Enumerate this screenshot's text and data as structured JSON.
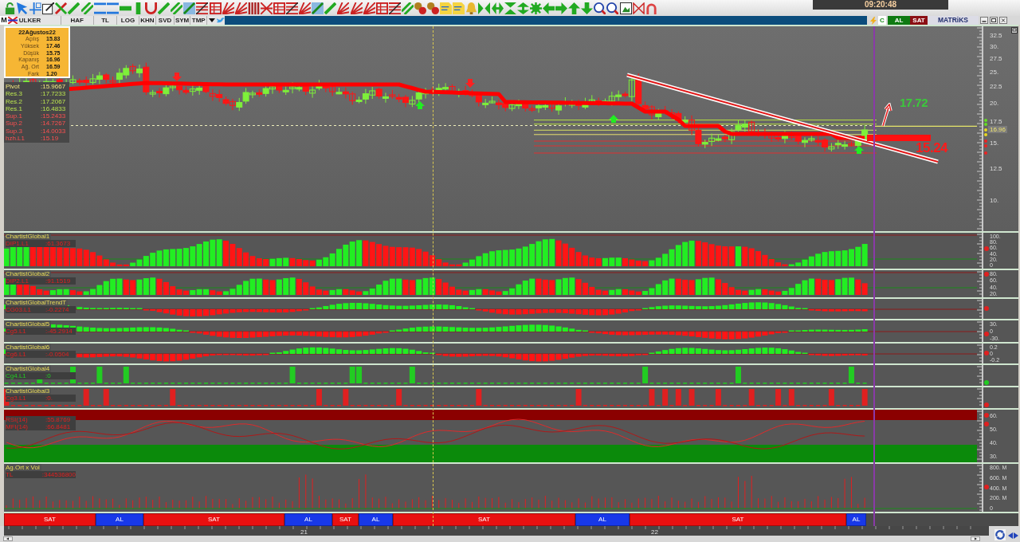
{
  "clock": "09:20:48",
  "symbol_bar": {
    "logo": "M",
    "symbol": "ULKER",
    "tabs": [
      "HAF",
      "TL",
      "LOG",
      "KHN",
      "SVD",
      "SYM",
      "TMP"
    ],
    "quick_buttons": [
      {
        "label": "C",
        "kind": "plain"
      },
      {
        "label": "AL",
        "kind": "buy"
      },
      {
        "label": "SAT",
        "kind": "sell"
      }
    ],
    "brand": "MATRiKS"
  },
  "info_box": {
    "title": "22Ağustos22",
    "rows": [
      {
        "label": "Açılış",
        "value": "15.83"
      },
      {
        "label": "Yüksek",
        "value": "17.46"
      },
      {
        "label": "Düşük",
        "value": "15.75"
      },
      {
        "label": "Kapanış",
        "value": "16.96"
      },
      {
        "label": "Ağ. Ort",
        "value": "16.59"
      },
      {
        "label": "Fark",
        "value": "1.20"
      }
    ]
  },
  "pivots": [
    {
      "label": "Pivot",
      "value": ":15.9667",
      "kind": "pivot"
    },
    {
      "label": "Res.3",
      "value": ":17.7233",
      "kind": "resistance"
    },
    {
      "label": "Res.2",
      "value": ":17.2067",
      "kind": "resistance"
    },
    {
      "label": "Res.1",
      "value": ":16.4833",
      "kind": "resistance"
    },
    {
      "label": "Sup.1",
      "value": ":15.2433",
      "kind": "support"
    },
    {
      "label": "Sup.2",
      "value": ":14.7267",
      "kind": "support"
    },
    {
      "label": "Sup.3",
      "value": ":14.0033",
      "kind": "support"
    },
    {
      "label": "hzh.L1",
      "value": ":15.19",
      "kind": "support"
    }
  ],
  "price_axis": {
    "ticks": [
      "32.5",
      "30.",
      "27.5",
      "25.",
      "22.5",
      "20.",
      "17.5",
      "15.",
      "12.5",
      "10."
    ],
    "last_price": "16.96"
  },
  "annotations": [
    {
      "text": "17.72",
      "kind": "target"
    },
    {
      "text": "15.24",
      "kind": "support"
    }
  ],
  "panels": [
    {
      "kind": "histogram",
      "title": "ChartistGlobal1",
      "series": [
        {
          "label": "DIP1.L1",
          "value": ":61.3673",
          "color": "#e02020"
        }
      ],
      "axis": [
        "100.",
        "80.",
        "60.",
        "40.",
        "20.",
        "0"
      ]
    },
    {
      "kind": "histogram",
      "title": "ChartistGlobal2",
      "series": [
        {
          "label": "DIP2.L1",
          "value": ":91.1519",
          "color": "#e02020"
        }
      ],
      "axis": [
        "80.",
        "60.",
        "40.",
        "20."
      ]
    },
    {
      "kind": "centered",
      "title": "ChartistGlobalTrendT",
      "series": [
        {
          "label": "CG03.L1",
          "value": ":-0.2274",
          "color": "#e02020"
        }
      ]
    },
    {
      "kind": "centered",
      "title": "ChartistGlobal5",
      "series": [
        {
          "label": "Cg5.L1",
          "value": ":-45.2914",
          "color": "#e02020"
        }
      ],
      "axis": [
        "30.",
        "0",
        "-30."
      ]
    },
    {
      "kind": "centered",
      "title": "ChartistGlobal6",
      "series": [
        {
          "label": "Cg6.L1",
          "value": ":-0.0504",
          "color": "#e02020"
        }
      ],
      "axis": [
        "0.2",
        "0",
        "-0.2"
      ]
    },
    {
      "kind": "spikes",
      "title": "ChartistGlobal4",
      "series": [
        {
          "label": "Cg4.L1",
          "value": ":0",
          "color": "#22cc22"
        }
      ]
    },
    {
      "kind": "spikes",
      "title": "ChartistGlobal3",
      "series": [
        {
          "label": "Cg3.L1",
          "value": ":0.",
          "color": "#e02020"
        }
      ]
    },
    {
      "kind": "bands",
      "series": [
        {
          "label": "RSI(14)",
          "value": ":55.8769",
          "color": "#e02020"
        },
        {
          "label": "MFI(14)",
          "value": ":66.8481",
          "color": "#e02020"
        }
      ],
      "axis": [
        "60.",
        "50.",
        "40.",
        "30."
      ]
    },
    {
      "kind": "volume",
      "title": "Ag.Ort x Vol",
      "series": [
        {
          "label": "TL",
          "value": ":344536800",
          "color": "#e02020"
        }
      ],
      "axis": [
        "800. M",
        "600. M",
        "400. M",
        "200. M",
        "0"
      ]
    }
  ],
  "signals": [
    {
      "label": "SAT",
      "kind": "sell"
    },
    {
      "label": "AL",
      "kind": "buy"
    },
    {
      "label": "SAT",
      "kind": "sell"
    },
    {
      "label": "AL",
      "kind": "buy"
    },
    {
      "label": "SAT",
      "kind": "sell"
    },
    {
      "label": "AL",
      "kind": "buy"
    },
    {
      "label": "SAT",
      "kind": "sell"
    },
    {
      "label": "AL",
      "kind": "buy"
    },
    {
      "label": "SAT",
      "kind": "sell"
    },
    {
      "label": "AL",
      "kind": "buy"
    }
  ],
  "dates": [
    "21",
    "22"
  ]
}
